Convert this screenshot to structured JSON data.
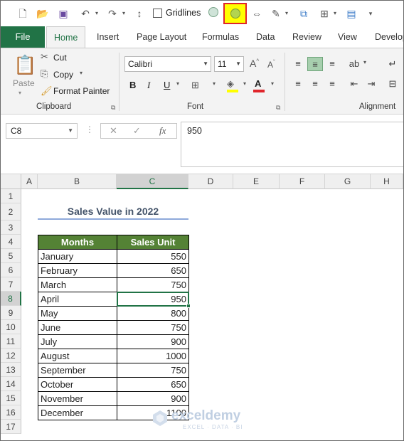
{
  "qat": {
    "gridlines_label": "Gridlines",
    "highlight_color": "#ffff00",
    "highlight_border": "#e0252b"
  },
  "tabs": [
    "File",
    "Home",
    "Insert",
    "Page Layout",
    "Formulas",
    "Data",
    "Review",
    "View",
    "Develop"
  ],
  "ribbon": {
    "paste_label": "Paste",
    "cut_label": "Cut",
    "copy_label": "Copy",
    "format_painter_label": "Format Painter",
    "clipboard_group": "Clipboard",
    "font_name": "Calibri",
    "font_size": "11",
    "font_group": "Font",
    "alignment_group": "Alignment"
  },
  "formula_bar": {
    "name_box": "C8",
    "fx_label": "fx",
    "value": "950"
  },
  "sheet": {
    "columns": [
      "A",
      "B",
      "C",
      "D",
      "E",
      "F",
      "G",
      "H"
    ],
    "rows": [
      "1",
      "2",
      "3",
      "4",
      "5",
      "6",
      "7",
      "8",
      "9",
      "10",
      "11",
      "12",
      "13",
      "14",
      "15",
      "16",
      "17"
    ],
    "title": "Sales Value in 2022",
    "headers": [
      "Months",
      "Sales Unit"
    ],
    "data": [
      [
        "January",
        "550"
      ],
      [
        "February",
        "650"
      ],
      [
        "March",
        "750"
      ],
      [
        "April",
        "950"
      ],
      [
        "May",
        "800"
      ],
      [
        "June",
        "750"
      ],
      [
        "July",
        "900"
      ],
      [
        "August",
        "1000"
      ],
      [
        "September",
        "750"
      ],
      [
        "October",
        "650"
      ],
      [
        "November",
        "900"
      ],
      [
        "December",
        "1100"
      ]
    ],
    "selected_cell": "C8"
  },
  "watermark": {
    "name": "exceldemy",
    "tagline": "EXCEL · DATA · BI"
  }
}
